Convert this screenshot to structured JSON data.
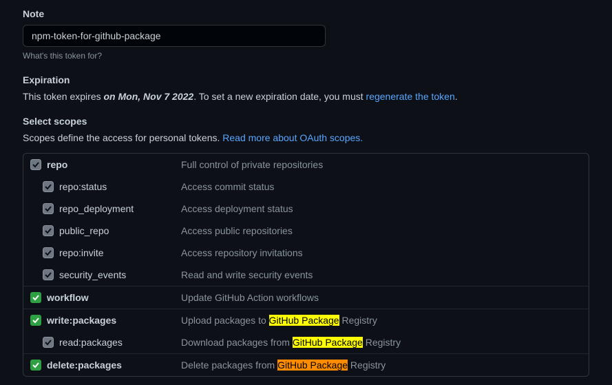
{
  "note": {
    "label": "Note",
    "value": "npm-token-for-github-package",
    "hint": "What's this token for?"
  },
  "expiration": {
    "label": "Expiration",
    "prefix": "This token expires ",
    "date": "on Mon, Nov 7 2022",
    "period": ".",
    "middle": " To set a new expiration date, you must ",
    "link": "regenerate the token",
    "suffix": "."
  },
  "scopes_section": {
    "label": "Select scopes",
    "desc": "Scopes define the access for personal tokens. ",
    "link": "Read more about OAuth scopes."
  },
  "scopes": {
    "repo": {
      "name": "repo",
      "desc": "Full control of private repositories",
      "children": [
        {
          "name": "repo:status",
          "desc": "Access commit status"
        },
        {
          "name": "repo_deployment",
          "desc": "Access deployment status"
        },
        {
          "name": "public_repo",
          "desc": "Access public repositories"
        },
        {
          "name": "repo:invite",
          "desc": "Access repository invitations"
        },
        {
          "name": "security_events",
          "desc": "Read and write security events"
        }
      ]
    },
    "workflow": {
      "name": "workflow",
      "desc": "Update GitHub Action workflows"
    },
    "write_packages": {
      "name": "write:packages",
      "desc_pre": "Upload packages to ",
      "desc_hl": "GitHub Package",
      "desc_post": " Registry",
      "children": [
        {
          "name": "read:packages",
          "desc_pre": "Download packages from ",
          "desc_hl": "GitHub Package",
          "desc_post": " Registry"
        }
      ]
    },
    "delete_packages": {
      "name": "delete:packages",
      "desc_pre": "Delete packages from ",
      "desc_hl": "GitHub Package",
      "desc_post": " Registry"
    }
  }
}
